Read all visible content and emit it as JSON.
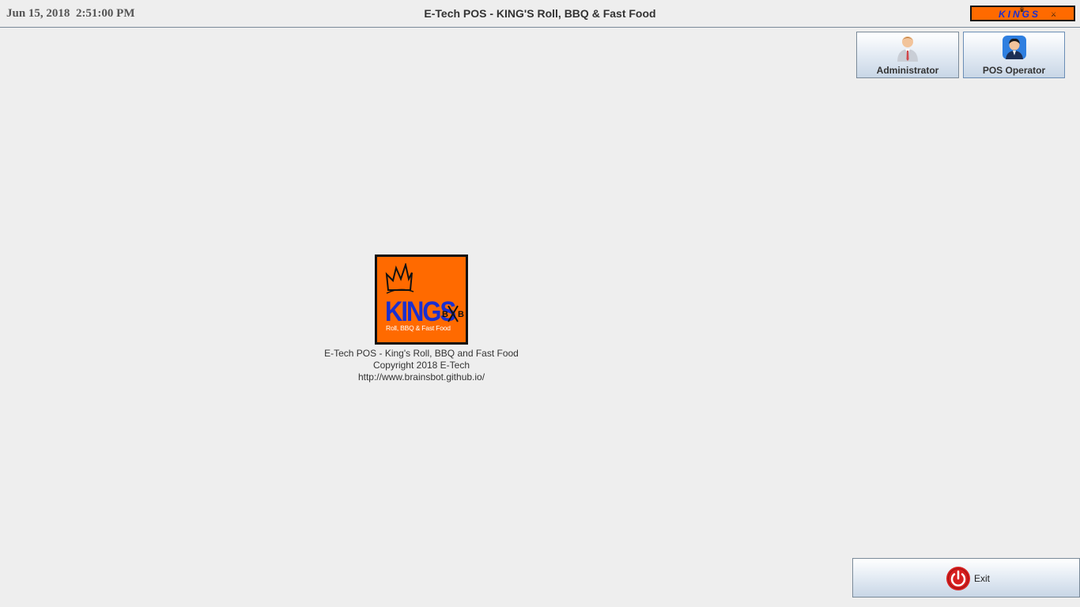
{
  "header": {
    "date": "Jun 15, 2018",
    "time": "2:51:00 PM",
    "title": "E-Tech POS - KING'S Roll, BBQ & Fast Food",
    "brand_logo_text": "KINGS"
  },
  "roles": [
    {
      "label": "Administrator",
      "icon": "administrator-avatar-icon"
    },
    {
      "label": "POS Operator",
      "icon": "pos-operator-avatar-icon"
    }
  ],
  "center_logo": {
    "brand": "KINGS",
    "tagline": "Roll, BBQ & Fast Food",
    "mark_left": "B",
    "mark_right": "B"
  },
  "about": {
    "line1": "E-Tech POS - King's Roll, BBQ and Fast Food",
    "line2": "Copyright 2018 E-Tech",
    "line3": "http://www.brainsbot.github.io/"
  },
  "footer": {
    "exit_label": "Exit",
    "exit_icon": "power-icon"
  },
  "colors": {
    "brand_orange": "#ff6a00",
    "brand_blue": "#1a2fd0",
    "exit_red": "#d62020"
  }
}
